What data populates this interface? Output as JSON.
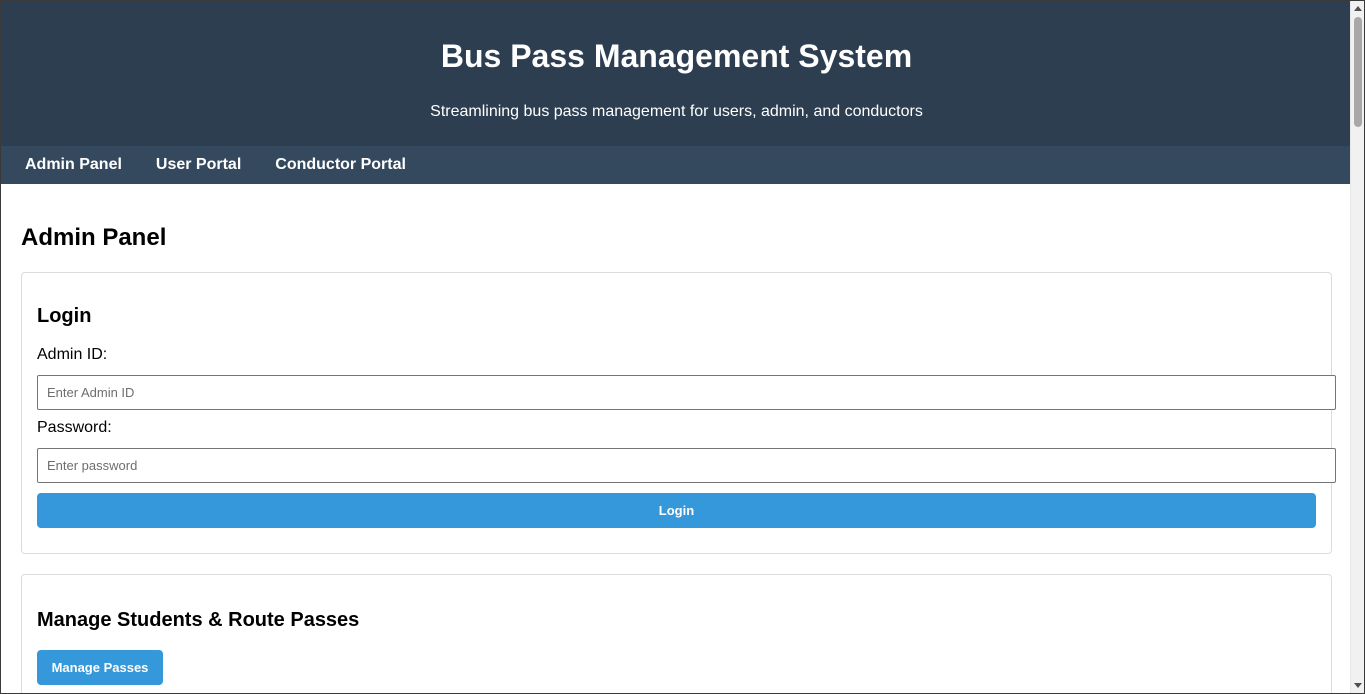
{
  "header": {
    "title": "Bus Pass Management System",
    "subtitle": "Streamlining bus pass management for users, admin, and conductors"
  },
  "nav": {
    "items": [
      {
        "label": "Admin Panel"
      },
      {
        "label": "User Portal"
      },
      {
        "label": "Conductor Portal"
      }
    ]
  },
  "main": {
    "page_title": "Admin Panel",
    "login": {
      "heading": "Login",
      "admin_id_label": "Admin ID:",
      "admin_id_placeholder": "Enter Admin ID",
      "admin_id_value": "",
      "password_label": "Password:",
      "password_placeholder": "Enter password",
      "password_value": "",
      "submit_label": "Login"
    },
    "manage": {
      "heading": "Manage Students & Route Passes",
      "button_label": "Manage Passes"
    }
  },
  "colors": {
    "header_bg": "#2c3e50",
    "nav_bg": "#34495e",
    "accent": "#3498db"
  }
}
